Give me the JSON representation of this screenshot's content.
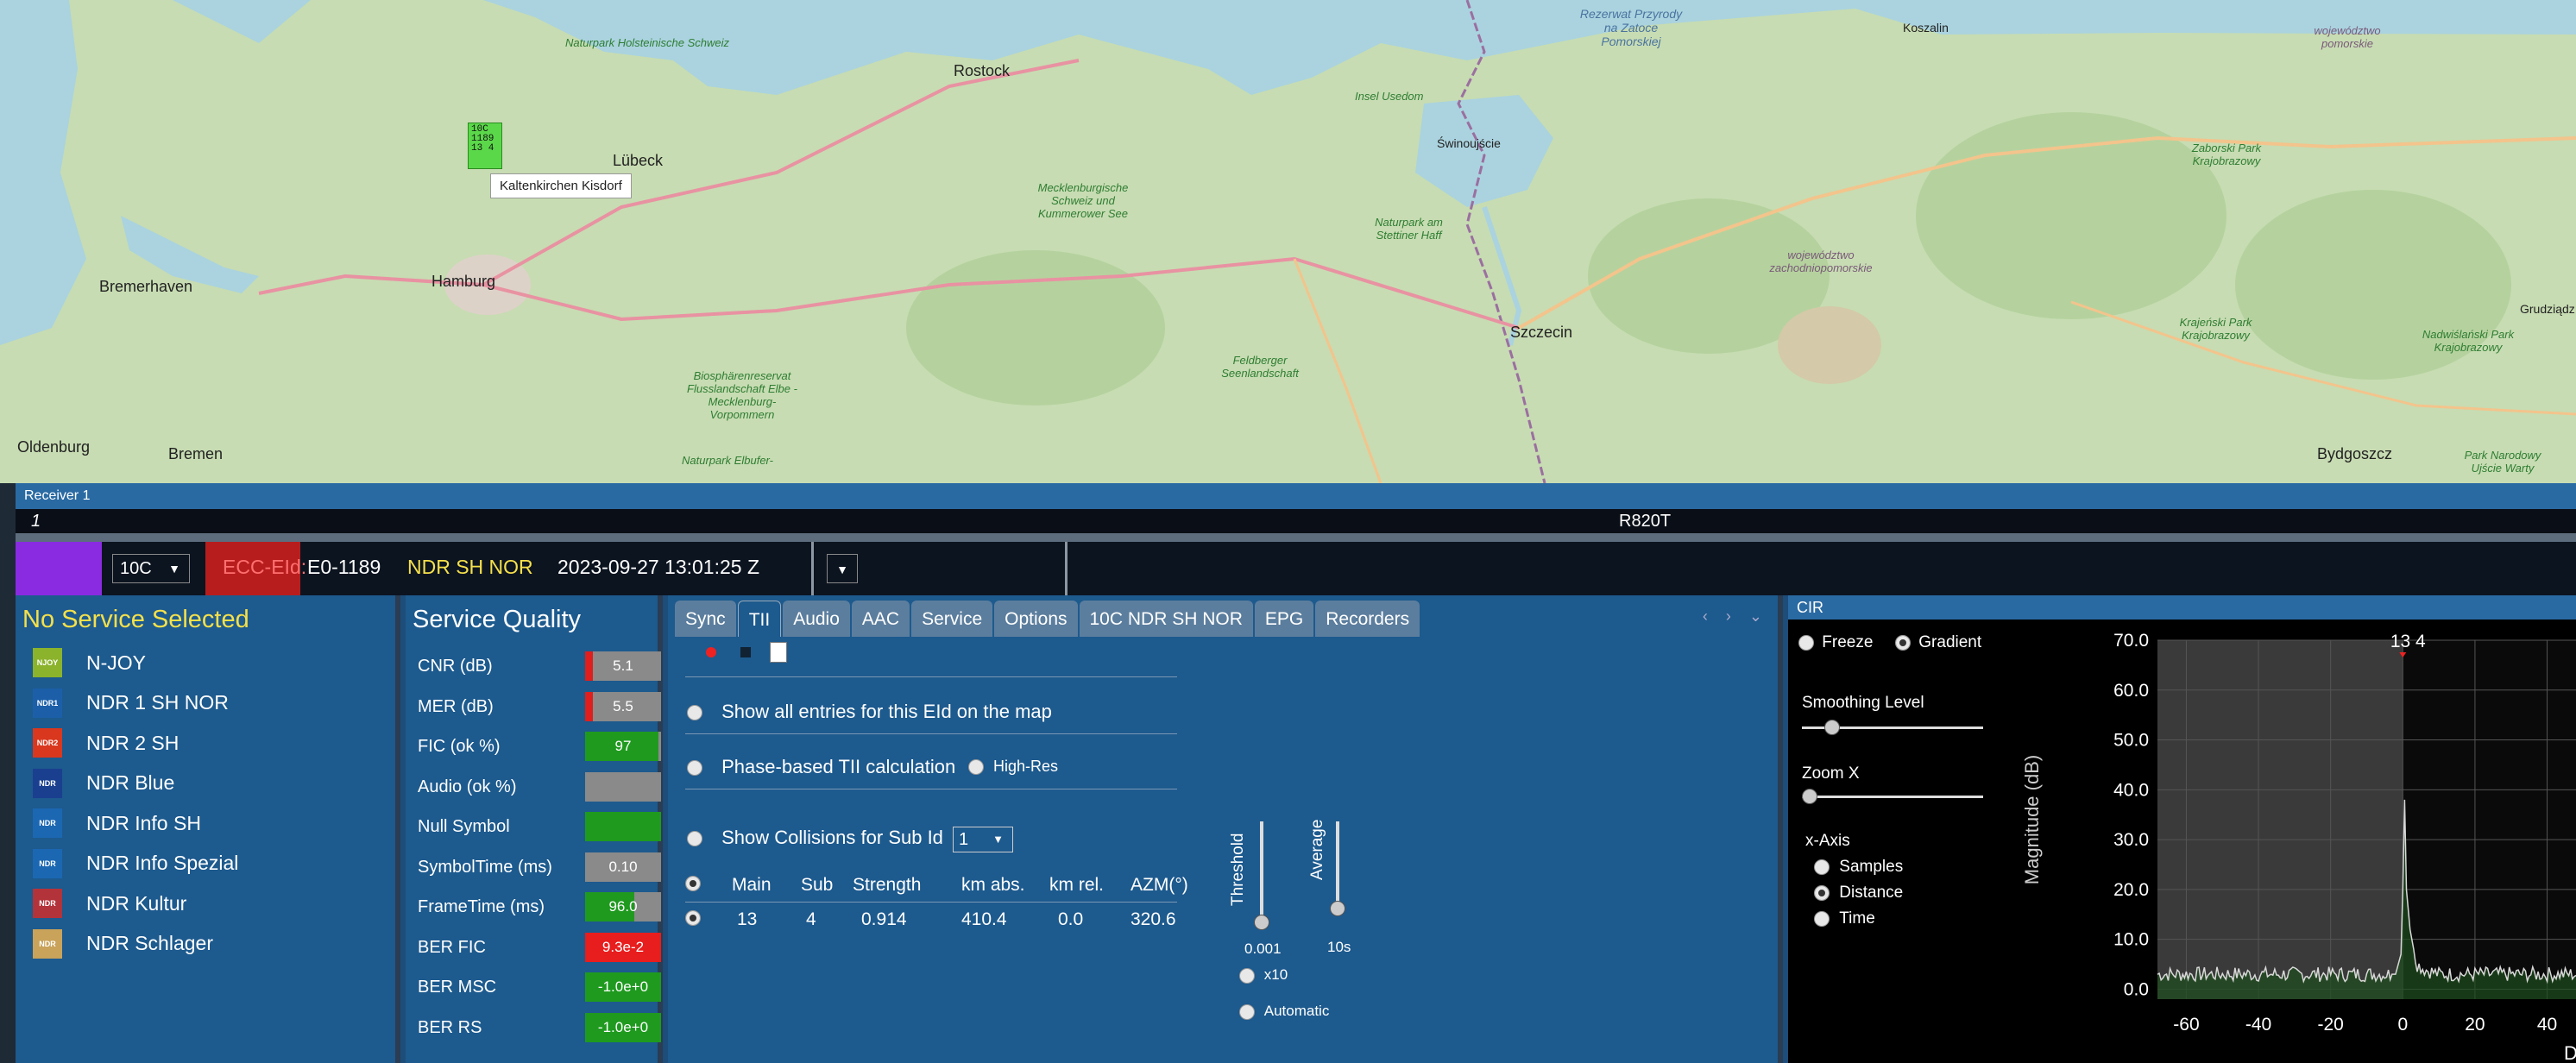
{
  "map": {
    "marker": {
      "lines": [
        "10C",
        "1189",
        "13 4"
      ]
    },
    "tooltip": "Kaltenkirchen Kisdorf",
    "labels": [
      {
        "text": "Naturpark Holsteinische Schweiz",
        "kind": "park"
      },
      {
        "text": "Lübeck",
        "kind": "city"
      },
      {
        "text": "Rostock",
        "kind": "city"
      },
      {
        "text": "Hamburg",
        "kind": "city"
      },
      {
        "text": "Bremerhaven",
        "kind": "city"
      },
      {
        "text": "Bremen",
        "kind": "city"
      },
      {
        "text": "Oldenburg",
        "kind": "city"
      },
      {
        "text": "Mecklenburgische Schweiz und Kummerower See",
        "kind": "park"
      },
      {
        "text": "Insel Usedom",
        "kind": "park"
      },
      {
        "text": "Świnoujście",
        "kind": "city"
      },
      {
        "text": "Naturpark am Stettiner Haff",
        "kind": "park"
      },
      {
        "text": "Szczecin",
        "kind": "city"
      },
      {
        "text": "Feldberger Seenlandschaft",
        "kind": "park"
      },
      {
        "text": "Biosphärenreservat Flusslandschaft Elbe - Mecklenburg-Vorpommern",
        "kind": "park"
      },
      {
        "text": "Naturpark Elbufer-",
        "kind": "park"
      },
      {
        "text": "województwo zachodniopomorskie",
        "kind": "region"
      },
      {
        "text": "Koszalin",
        "kind": "city"
      },
      {
        "text": "województwo pomorskie",
        "kind": "region"
      },
      {
        "text": "Zaborski Park Krajobrazowy",
        "kind": "park"
      },
      {
        "text": "Krajeński Park Krajobrazowy",
        "kind": "park"
      },
      {
        "text": "Nadwiślański Park Krajobrazowy",
        "kind": "park"
      },
      {
        "text": "Grudziądz",
        "kind": "city"
      },
      {
        "text": "Bydgoszcz",
        "kind": "city"
      },
      {
        "text": "Park Narodowy Ujście Warty",
        "kind": "park"
      },
      {
        "text": "Rezerwat Przyrody na Zatoce Pomorskiej",
        "kind": "sea"
      }
    ]
  },
  "receiver": {
    "window_title": "Receiver 1",
    "status_left": "1",
    "tuner": "R820T"
  },
  "toolbar": {
    "channel": "10C",
    "ecc_label": "ECC-EId:",
    "eid": "E0-1189",
    "ensemble": "NDR SH NOR",
    "datetime": "2023-09-27  13:01:25 Z"
  },
  "services": {
    "title": "No Service Selected",
    "items": [
      {
        "label": "N-JOY",
        "logo": "NJOY",
        "color": "#8bb32c"
      },
      {
        "label": "NDR 1 SH NOR",
        "logo": "NDR1",
        "color": "#1c5fa8"
      },
      {
        "label": "NDR 2 SH",
        "logo": "NDR2",
        "color": "#d9381e"
      },
      {
        "label": "NDR Blue",
        "logo": "NDR",
        "color": "#1a3f8f"
      },
      {
        "label": "NDR Info SH",
        "logo": "NDR",
        "color": "#1b67b2"
      },
      {
        "label": "NDR Info Spezial",
        "logo": "NDR",
        "color": "#1b67b2"
      },
      {
        "label": "NDR Kultur",
        "logo": "NDR",
        "color": "#b3333a"
      },
      {
        "label": "NDR Schlager",
        "logo": "NDR",
        "color": "#c9a35a"
      }
    ]
  },
  "quality": {
    "title": "Service Quality",
    "rows": [
      {
        "label": "CNR (dB)",
        "value": "5.1",
        "fill": 0.1,
        "color": "#e01e1e"
      },
      {
        "label": "MER (dB)",
        "value": "5.5",
        "fill": 0.1,
        "color": "#e01e1e"
      },
      {
        "label": "FIC (ok %)",
        "value": "97",
        "fill": 0.97,
        "color": "#1f9a1f"
      },
      {
        "label": "Audio (ok %)",
        "value": "",
        "fill": 0.0,
        "color": "#8a8a8a"
      },
      {
        "label": "Null Symbol",
        "value": "",
        "fill": 1.0,
        "color": "#1f9a1f"
      },
      {
        "label": "SymbolTime (ms)",
        "value": "0.10",
        "fill": 0.0,
        "color": "#8a8a8a"
      },
      {
        "label": "FrameTime (ms)",
        "value": "96.0",
        "fill": 0.65,
        "color": "#1f9a1f"
      },
      {
        "label": "BER FIC",
        "value": "9.3e-2",
        "fill": 1.0,
        "color": "#e81d1d"
      },
      {
        "label": "BER MSC",
        "value": "-1.0e+0",
        "fill": 1.0,
        "color": "#1f9a1f"
      },
      {
        "label": "BER RS",
        "value": "-1.0e+0",
        "fill": 1.0,
        "color": "#1f9a1f"
      }
    ]
  },
  "tabs": [
    "Sync",
    "TII",
    "Audio",
    "AAC",
    "Service",
    "Options",
    "10C NDR SH NOR",
    "EPG",
    "Recorders"
  ],
  "tii": {
    "show_all_label": "Show all entries for this EId on the map",
    "phase_label": "Phase-based TII calculation",
    "highres_label": "High-Res",
    "collisions_label": "Show Collisions for Sub Id",
    "subid": "1",
    "columns": [
      "Main",
      "Sub",
      "Strength",
      "km abs.",
      "km rel.",
      "AZM(°)"
    ],
    "rows": [
      {
        "main": "13",
        "sub": "4",
        "strength": "0.914",
        "km_abs": "410.4",
        "km_rel": "0.0",
        "azm": "320.6"
      }
    ],
    "threshold_label": "Threshold",
    "threshold_value": "0.001",
    "average_label": "Average",
    "average_value": "10s",
    "x10_label": "x10",
    "automatic_label": "Automatic"
  },
  "cir": {
    "title": "CIR",
    "freeze_label": "Freeze",
    "gradient_label": "Gradient",
    "smoothing_label": "Smoothing Level",
    "zoom_label": "Zoom X",
    "xaxis_label": "x-Axis",
    "xaxis_options": [
      "Samples",
      "Distance",
      "Time"
    ],
    "xaxis_selected": "Distance",
    "ylabel": "Magnitude (dB)",
    "xlabel_partial": "D",
    "peak_label": "13 4",
    "yticks": [
      "70.0",
      "60.0",
      "50.0",
      "40.0",
      "30.0",
      "20.0",
      "10.0",
      "0.0"
    ],
    "xticks": [
      "-60",
      "-40",
      "-20",
      "0",
      "20",
      "40"
    ]
  },
  "chart_data": {
    "type": "line",
    "title": "",
    "xlabel": "D",
    "ylabel": "Magnitude (dB)",
    "xlim": [
      -68,
      48
    ],
    "ylim": [
      -2,
      70
    ],
    "series": [
      {
        "x": [
          -68,
          -60,
          -50,
          -40,
          -30,
          -20,
          -10,
          -2,
          -0.5,
          0,
          0.5,
          1,
          2,
          3,
          4,
          6,
          10,
          20,
          30,
          40,
          48
        ],
        "y": [
          3,
          3,
          3,
          3,
          3,
          3,
          3,
          3,
          7,
          20,
          38,
          20,
          12,
          8,
          5,
          4,
          3,
          3,
          3,
          3,
          3
        ]
      }
    ],
    "grid": true,
    "legend": "none"
  }
}
